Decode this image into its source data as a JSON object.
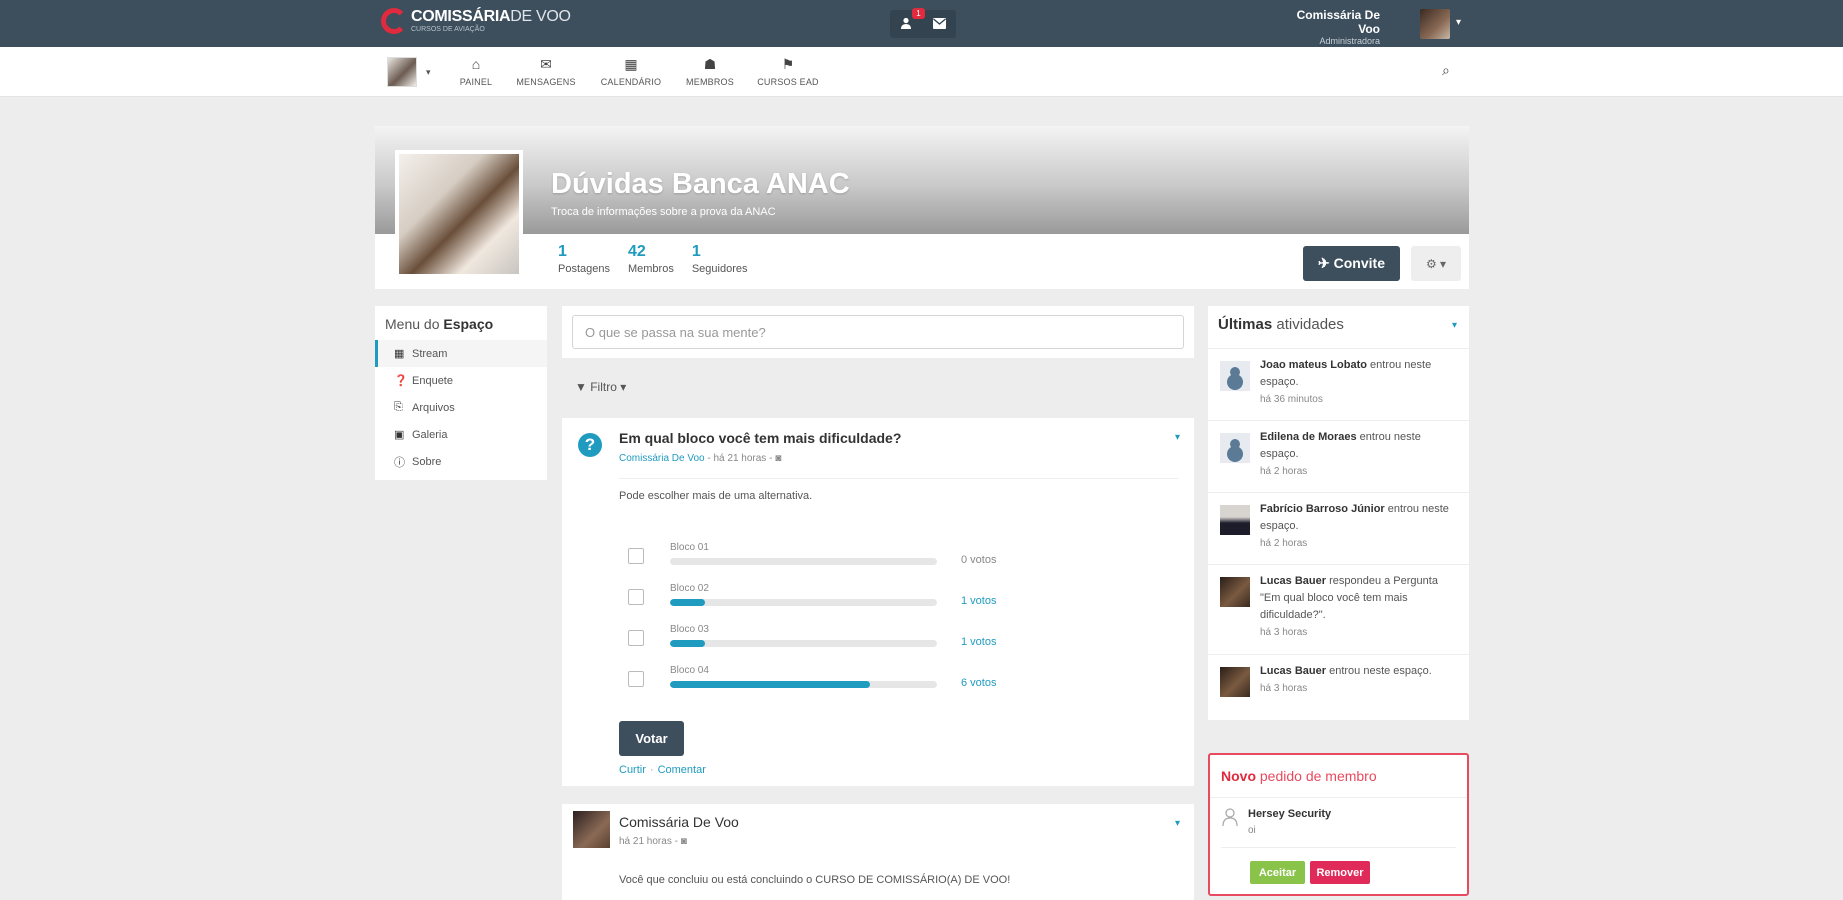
{
  "topbar": {
    "logo_brand": "COMISSÁRIA",
    "logo_brand_thin": "DE VOO",
    "logo_tag": "CURSOS DE AVIAÇÃO",
    "notification_badge": "1",
    "notification_icon": "user-icon",
    "messages_icon": "envelope-icon",
    "user_name": "Comissária De Voo",
    "user_role": "Administradora",
    "caret": "▾"
  },
  "subnav": {
    "items": [
      {
        "label": "PAINEL",
        "icon": "⌂"
      },
      {
        "label": "MENSAGENS",
        "icon": "✉"
      },
      {
        "label": "CALENDÁRIO",
        "icon": "▦"
      },
      {
        "label": "MEMBROS",
        "icon": "☗"
      },
      {
        "label": "CURSOS EAD",
        "icon": "⚑"
      }
    ],
    "search_icon": "⌕"
  },
  "space": {
    "title": "Dúvidas Banca ANAC",
    "subtitle": "Troca de informações sobre a prova da ANAC",
    "stats": [
      {
        "value": "1",
        "label": "Postagens"
      },
      {
        "value": "42",
        "label": "Membros"
      },
      {
        "value": "1",
        "label": "Seguidores"
      }
    ],
    "invite_label": "✈ Convite",
    "gear_label": "⚙ ▾"
  },
  "space_menu": {
    "title_prefix": "Menu do",
    "title_bold": "Espaço",
    "items": [
      {
        "label": "Stream",
        "icon": "▦"
      },
      {
        "label": "Enquete",
        "icon": "❓"
      },
      {
        "label": "Arquivos",
        "icon": "⎘"
      },
      {
        "label": "Galeria",
        "icon": "▣"
      },
      {
        "label": "Sobre",
        "icon": "ⓘ"
      }
    ]
  },
  "post_box": {
    "placeholder": "O que se passa na sua mente?"
  },
  "filter": {
    "label": "▼ Filtro ▾"
  },
  "poll": {
    "icon": "?",
    "question": "Em qual bloco você tem mais dificuldade?",
    "author": "Comissária De Voo",
    "meta": " - há 21 horas - ",
    "meta_icon": "◙",
    "description": "Pode escolher mais de uma alternativa.",
    "options": [
      {
        "label": "Bloco 01",
        "votes": "0 votos",
        "share": 0
      },
      {
        "label": "Bloco 02",
        "votes": "1 votos",
        "share": 0.13
      },
      {
        "label": "Bloco 03",
        "votes": "1 votos",
        "share": 0.13
      },
      {
        "label": "Bloco 04",
        "votes": "6 votos",
        "share": 0.75
      }
    ],
    "vote_label": "Votar",
    "like_label": "Curtir",
    "comment_label": "Comentar",
    "caret": "▾"
  },
  "post": {
    "author": "Comissária De Voo",
    "meta": "há 21 horas - ◙",
    "text": "Você que concluiu ou está concluindo o CURSO DE COMISSÁRIO(A) DE VOO!",
    "caret": "▾"
  },
  "activity": {
    "title_bold": "Últimas",
    "title_rest": "atividades",
    "caret": "▾",
    "items": [
      {
        "name": "Joao mateus Lobato",
        "action": "entrou neste espaço.",
        "time": "há 36 minutos",
        "avatar": "gray"
      },
      {
        "name": "Edilena de Moraes",
        "action": "entrou neste espaço.",
        "time": "há 2 horas",
        "avatar": "gray"
      },
      {
        "name": "Fabrício Barroso Júnior",
        "action": "entrou neste espaço.",
        "time": "há 2 horas",
        "avatar": "suit"
      },
      {
        "name": "Lucas Bauer",
        "action": "respondeu a Pergunta \"Em qual bloco você tem mais dificuldade?\".",
        "time": "há 3 horas",
        "avatar": "dark"
      },
      {
        "name": "Lucas Bauer",
        "action": "entrou neste espaço.",
        "time": "há 3 horas",
        "avatar": "dark"
      }
    ]
  },
  "member_request": {
    "title_bold": "Novo",
    "title_rest": "pedido de membro",
    "icon": "user-icon",
    "name": "Hersey Security",
    "message": "oi",
    "accept_label": "Aceitar",
    "remove_label": "Remover"
  },
  "colors": {
    "accent": "#1f9bc0",
    "dark": "#3d4e5d",
    "danger": "#e02b3e",
    "success": "#8ac34a"
  }
}
